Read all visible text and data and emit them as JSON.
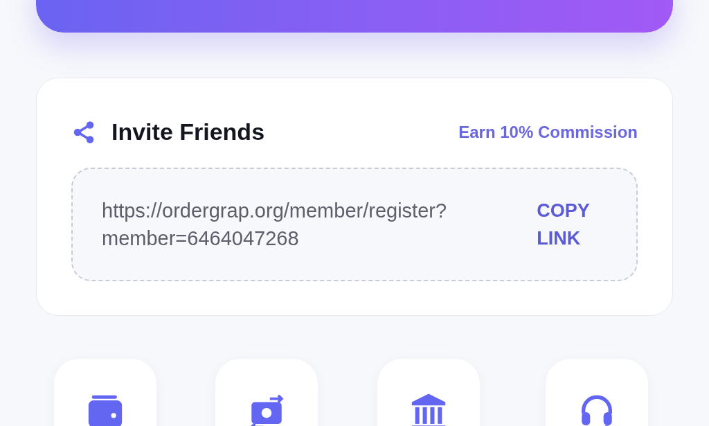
{
  "invite": {
    "title": "Invite Friends",
    "commission": "Earn 10% Commission",
    "link": "https://ordergrap.org/member/register?member=6464047268",
    "copy_button": "COPY LINK"
  },
  "actions": [
    {
      "kind": "wallet"
    },
    {
      "kind": "exchange"
    },
    {
      "kind": "bank"
    },
    {
      "kind": "support"
    }
  ]
}
